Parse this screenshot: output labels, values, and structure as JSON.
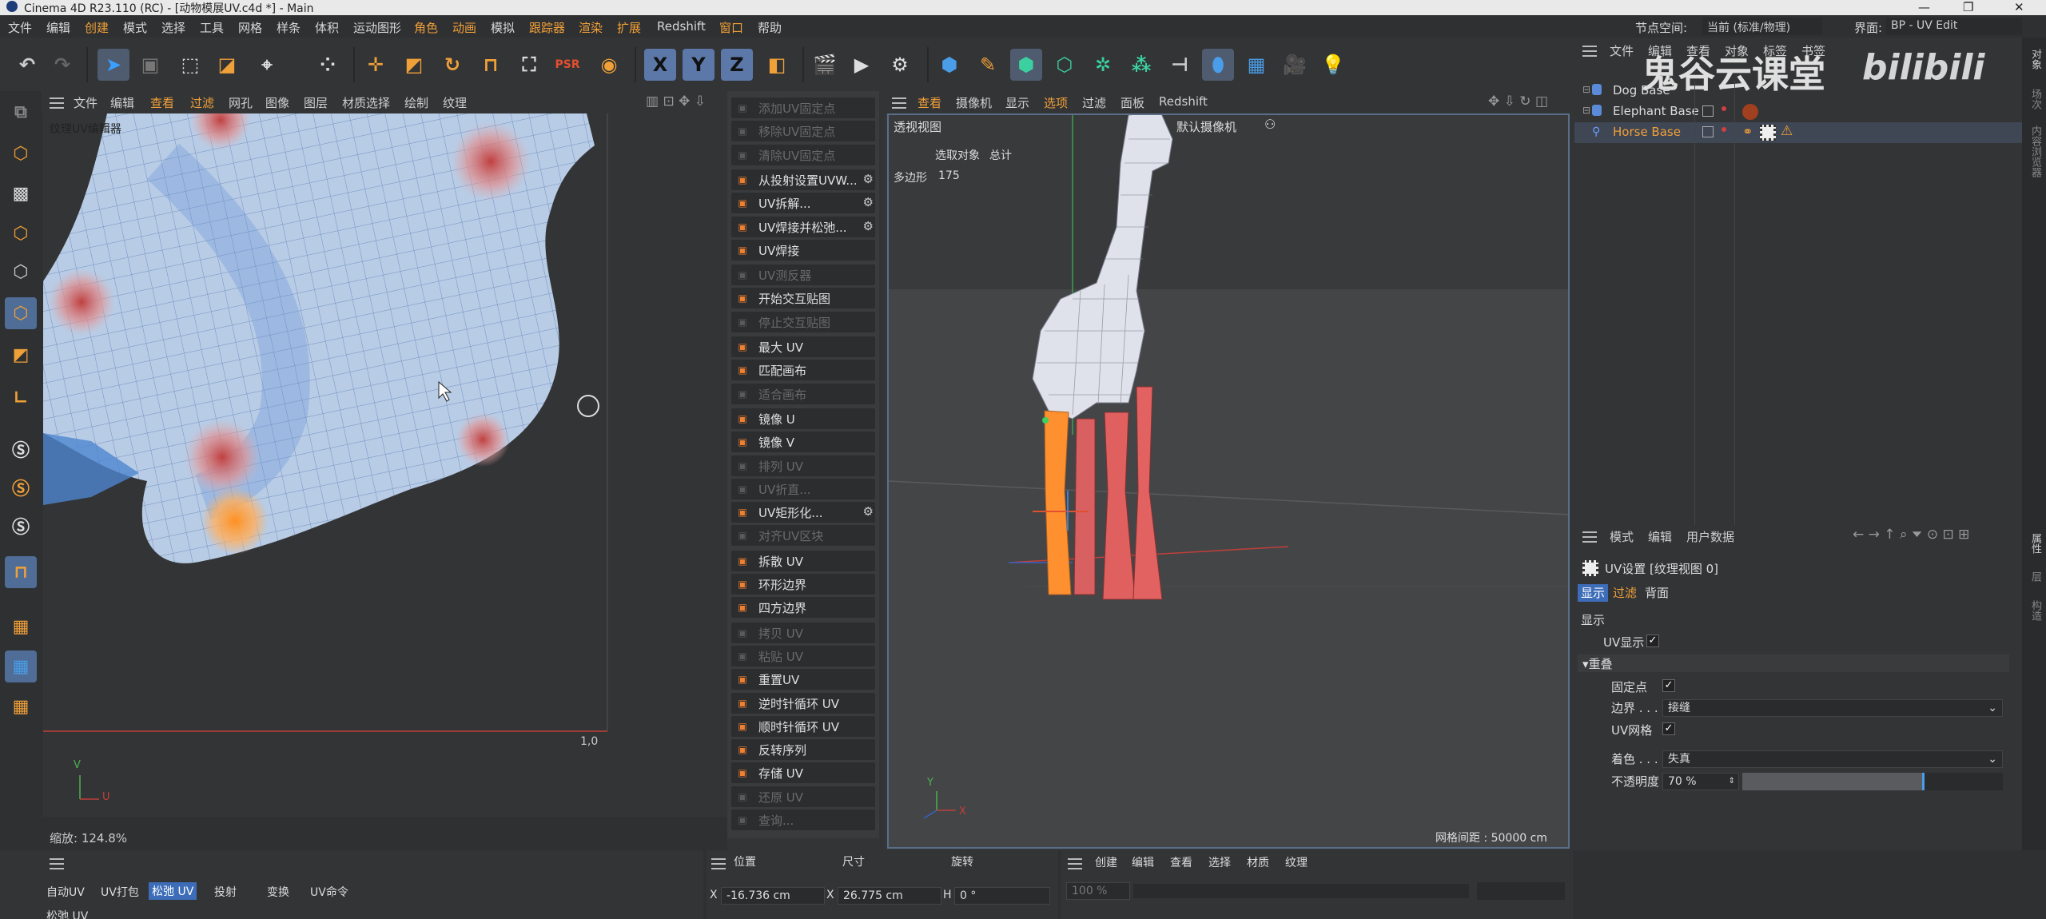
{
  "window": {
    "title": "Cinema 4D R23.110 (RC) - [动物模展UV.c4d *] - Main",
    "minimize": "—",
    "maximize": "❐",
    "close": "✕"
  },
  "menu": {
    "items": [
      "文件",
      "编辑",
      "创建",
      "模式",
      "选择",
      "工具",
      "网格",
      "样条",
      "体积",
      "运动图形",
      "角色",
      "动画",
      "模拟",
      "跟踪器",
      "渲染",
      "扩展",
      "Redshift",
      "窗口",
      "帮助"
    ],
    "node_space_label": "节点空间:",
    "node_space_value": "当前 (标准/物理)",
    "layout_label": "界面:",
    "layout_value": "BP - UV Edit"
  },
  "uv_editor": {
    "menu": [
      "文件",
      "编辑",
      "查看",
      "过滤",
      "网孔",
      "图像",
      "图层",
      "材质选择",
      "绘制",
      "纹理"
    ],
    "title": "纹理UV编辑器",
    "coord_label": "1,0",
    "axis_v": "V",
    "axis_u": "U",
    "zoom_label": "缩放: 124.8%"
  },
  "uv_commands": [
    {
      "label": "添加UV固定点",
      "enabled": false,
      "icon": "pin-add-icon"
    },
    {
      "label": "移除UV固定点",
      "enabled": false,
      "icon": "pin-remove-icon"
    },
    {
      "label": "清除UV固定点",
      "enabled": false,
      "icon": "pin-clear-icon"
    },
    {
      "label": "从投射设置UVW...",
      "enabled": true,
      "icon": "projection-icon",
      "gear": true
    },
    {
      "label": "UV拆解...",
      "enabled": true,
      "icon": "unwrap-icon",
      "gear": true
    },
    {
      "label": "UV焊接并松弛...",
      "enabled": true,
      "icon": "weld-relax-icon",
      "gear": true
    },
    {
      "label": "UV焊接",
      "enabled": true,
      "icon": "weld-icon"
    },
    {
      "label": "UV测反器",
      "enabled": false,
      "icon": "inverse-icon"
    },
    {
      "label": "开始交互贴图",
      "enabled": true,
      "icon": "interactive-map-icon"
    },
    {
      "label": "停止交互贴图",
      "enabled": false,
      "icon": "stop-map-icon"
    },
    {
      "label": "最大 UV",
      "enabled": true,
      "icon": "maximize-uv-icon"
    },
    {
      "label": "匹配画布",
      "enabled": true,
      "icon": "fit-canvas-icon"
    },
    {
      "label": "适合画布",
      "enabled": false,
      "icon": "fit-canvas-alt-icon"
    },
    {
      "label": "镜像 U",
      "enabled": true,
      "icon": "mirror-u-icon"
    },
    {
      "label": "镜像 V",
      "enabled": true,
      "icon": "mirror-v-icon"
    },
    {
      "label": "排列 UV",
      "enabled": false,
      "icon": "arrange-icon"
    },
    {
      "label": "UV折直...",
      "enabled": false,
      "icon": "straighten-icon"
    },
    {
      "label": "UV矩形化...",
      "enabled": true,
      "icon": "rectangularize-icon",
      "gear": true
    },
    {
      "label": "对齐UV区块",
      "enabled": false,
      "icon": "align-icon"
    },
    {
      "label": "拆散 UV",
      "enabled": true,
      "icon": "split-uv-icon"
    },
    {
      "label": "环形边界",
      "enabled": true,
      "icon": "ring-border-icon"
    },
    {
      "label": "四方边界",
      "enabled": true,
      "icon": "square-border-icon"
    },
    {
      "label": "拷贝 UV",
      "enabled": false,
      "icon": "copy-uv-icon"
    },
    {
      "label": "粘贴 UV",
      "enabled": false,
      "icon": "paste-uv-icon"
    },
    {
      "label": "重置UV",
      "enabled": true,
      "icon": "reset-uv-icon"
    },
    {
      "label": "逆时针循环 UV",
      "enabled": true,
      "icon": "ccw-cycle-icon"
    },
    {
      "label": "顺时针循环 UV",
      "enabled": true,
      "icon": "cw-cycle-icon"
    },
    {
      "label": "反转序列",
      "enabled": true,
      "icon": "reverse-icon"
    },
    {
      "label": "存储 UV",
      "enabled": true,
      "icon": "store-uv-icon"
    },
    {
      "label": "还原 UV",
      "enabled": false,
      "icon": "restore-uv-icon"
    },
    {
      "label": "查询...",
      "enabled": false,
      "icon": "query-icon"
    }
  ],
  "viewport": {
    "menu": [
      "查看",
      "摄像机",
      "显示",
      "选项",
      "过滤",
      "面板",
      "Redshift"
    ],
    "name": "透视视图",
    "camera": "默认摄像机",
    "hud_header_1": "选取对象",
    "hud_header_2": "总计",
    "hud_row_label": "多边形",
    "hud_row_value": "175",
    "grid_spacing": "网格间距 : 50000 cm",
    "axis_x": "X",
    "axis_y": "Y"
  },
  "object_manager": {
    "menu": [
      "文件",
      "编辑",
      "查看",
      "对象",
      "标签",
      "书签"
    ],
    "watermark": "鬼谷云课堂",
    "watermark2": "bilibili",
    "objects": [
      {
        "name": "Dog Base",
        "selected": false
      },
      {
        "name": "Elephant Base",
        "selected": false
      },
      {
        "name": "Horse Base",
        "selected": true
      }
    ]
  },
  "attributes": {
    "menu": [
      "模式",
      "编辑",
      "用户数据"
    ],
    "title": "UV设置 [纹理视图 0]",
    "tabs": [
      "显示",
      "过滤",
      "背面"
    ],
    "section_display": "显示",
    "uv_display_label": "UV显示",
    "overlay_label": "重叠",
    "fixed_points_label": "固定点",
    "border_label": "边界 . . .",
    "border_value": "接缝",
    "uv_mesh_label": "UV网格",
    "shading_label": "着色 . . .",
    "shading_value": "失真",
    "opacity_label": "不透明度",
    "opacity_value": "70 %",
    "opacity_fraction": 0.7
  },
  "bottom": {
    "uv_tabs": [
      "自动UV",
      "UV打包",
      "松弛 UV",
      "投射",
      "变换",
      "UV命令"
    ],
    "uv_tab_active": "松弛 UV",
    "relax_label": "松弛 UV",
    "coord_headers": [
      "位置",
      "尺寸",
      "旋转"
    ],
    "pos_x": "-16.736 cm",
    "size_x": "26.775 cm",
    "rot_h": "0 °",
    "axis_x": "X",
    "axis_h": "H",
    "mat_menu": [
      "创建",
      "编辑",
      "查看",
      "选择",
      "材质",
      "纹理"
    ],
    "mat_zoom": "100 %"
  },
  "side_tabs": [
    "对象",
    "场次",
    "内容浏览器",
    "属性",
    "层",
    "构造"
  ],
  "colors": {
    "accent": "#f0a038",
    "selected_blue": "#4f6d96",
    "active_tab": "#3d6db8"
  }
}
